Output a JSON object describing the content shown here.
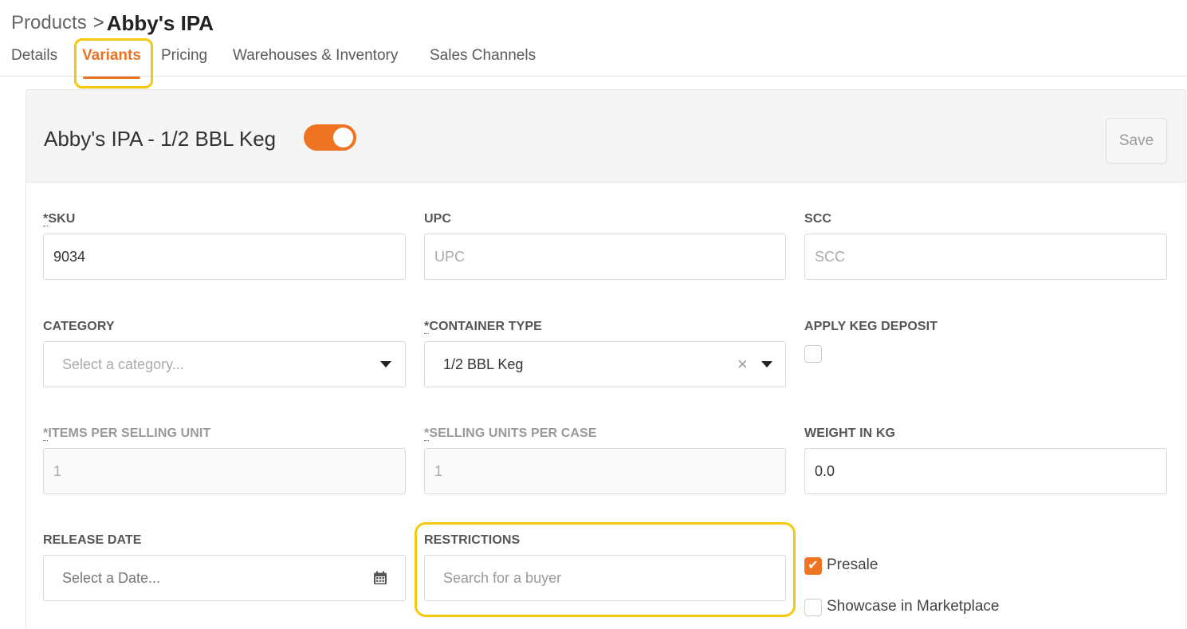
{
  "breadcrumb": {
    "parent": "Products",
    "separator": ">",
    "current": "Abby's IPA"
  },
  "tabs": [
    {
      "label": "Details"
    },
    {
      "label": "Variants",
      "active": true
    },
    {
      "label": "Pricing"
    },
    {
      "label": "Warehouses & Inventory"
    },
    {
      "label": "Sales Channels"
    }
  ],
  "variant": {
    "title": "Abby's IPA - 1/2 BBL Keg",
    "enabled": true,
    "save_label": "Save"
  },
  "fields": {
    "sku": {
      "required_mark": "*",
      "label": "SKU",
      "value": "9034"
    },
    "upc": {
      "label": "UPC",
      "placeholder": "UPC"
    },
    "scc": {
      "label": "SCC",
      "placeholder": "SCC"
    },
    "category": {
      "label": "CATEGORY",
      "placeholder": "Select a category..."
    },
    "container_type": {
      "required_mark": "*",
      "label": "CONTAINER TYPE",
      "value": "1/2 BBL Keg",
      "clear": "×"
    },
    "apply_keg_deposit": {
      "label": "APPLY KEG DEPOSIT",
      "checked": false
    },
    "items_per_selling_unit": {
      "required_mark": "*",
      "label": "ITEMS PER SELLING UNIT",
      "value": "1"
    },
    "selling_units_per_case": {
      "required_mark": "*",
      "label": "SELLING UNITS PER CASE",
      "value": "1"
    },
    "weight_in_kg": {
      "label": "WEIGHT IN KG",
      "value": "0.0"
    },
    "release_date": {
      "label": "RELEASE DATE",
      "placeholder": "Select a Date..."
    },
    "restrictions": {
      "label": "RESTRICTIONS",
      "placeholder": "Search for a buyer"
    },
    "presale": {
      "label": "Presale",
      "checked": true,
      "check_glyph": "✔"
    },
    "showcase": {
      "label": "Showcase in Marketplace",
      "checked": false
    }
  },
  "colors": {
    "accent": "#ef7422",
    "highlight": "#f6c90e"
  },
  "icons": {
    "calendar": "calendar-icon",
    "dropdown": "chevron-down-icon",
    "clear": "close-icon",
    "chevron": "chevron-right-icon"
  }
}
